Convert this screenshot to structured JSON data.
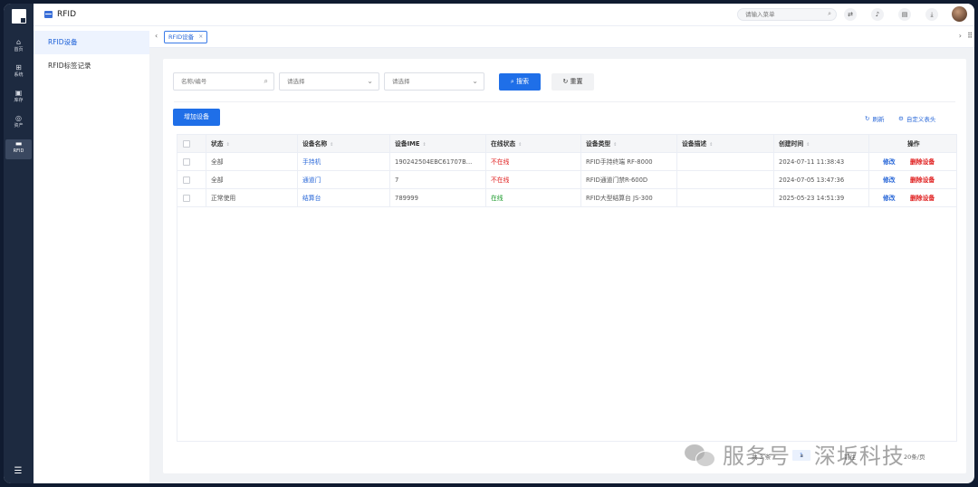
{
  "rail": {
    "items": [
      {
        "label": "首页",
        "icon": "home-icon",
        "glyph": "⌂"
      },
      {
        "label": "系统",
        "icon": "grid-icon",
        "glyph": "⊞"
      },
      {
        "label": "库存",
        "icon": "box-icon",
        "glyph": "▣"
      },
      {
        "label": "资产",
        "icon": "target-icon",
        "glyph": "◎"
      },
      {
        "label": "RFID",
        "icon": "card-icon",
        "glyph": "▬"
      }
    ],
    "active": "RFID"
  },
  "topbar": {
    "title": "RFID",
    "search_placeholder": "请输入菜单"
  },
  "subnav": {
    "items": [
      {
        "label": "RFID设备",
        "active": true
      },
      {
        "label": "RFID标签记录",
        "active": false
      }
    ]
  },
  "tags": {
    "current": "RFID设备"
  },
  "filters": {
    "name_placeholder": "名称/编号",
    "select1_placeholder": "请选择",
    "select2_placeholder": "请选择",
    "search_label": "搜索",
    "reset_label": "重置"
  },
  "toolbar": {
    "add_label": "增加设备",
    "refresh_label": "刷新",
    "custom_header_label": "自定义表头"
  },
  "table": {
    "columns": [
      "状态",
      "设备名称",
      "设备IME",
      "在线状态",
      "设备类型",
      "设备描述",
      "创建时间",
      "操作"
    ],
    "rows": [
      {
        "status": "全部",
        "name": "手持机",
        "ime": "190242504EBC61707B...",
        "online": "不在线",
        "type": "RFID手持终端 RF-8000",
        "desc": "",
        "created": "2024-07-11 11:38:43"
      },
      {
        "status": "全部",
        "name": "通道门",
        "ime": "7",
        "online": "不在线",
        "type": "RFID通道门禁R-600D",
        "desc": "",
        "created": "2024-07-05 13:47:36"
      },
      {
        "status": "正常使用",
        "name": "结算台",
        "ime": "789999",
        "online": "在线",
        "type": "RFID大型结算台 JS-300",
        "desc": "",
        "created": "2025-05-23 14:51:39"
      }
    ],
    "action_edit": "修改",
    "action_delete": "删除设备"
  },
  "pager": {
    "total": "共 3 条",
    "page": "1",
    "goto": "前往",
    "size": "20条/页"
  },
  "watermark": {
    "text": "服务号 · 深坂科技"
  },
  "colors": {
    "primary": "#1f6fe8",
    "rail": "#1d2a40",
    "danger": "#e02020",
    "success": "#1a9a2a"
  }
}
